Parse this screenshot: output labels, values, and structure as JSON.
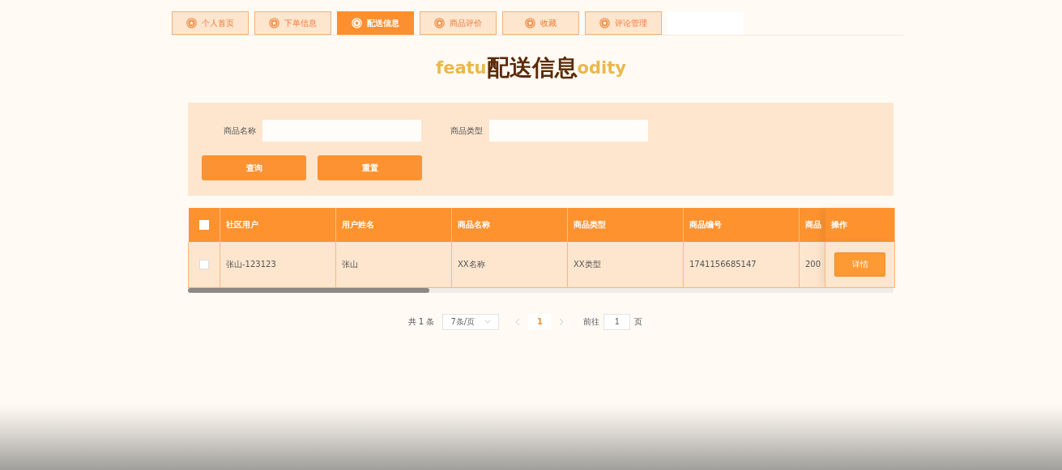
{
  "tabs": [
    {
      "label": "个人首页",
      "selected": false
    },
    {
      "label": "下单信息",
      "selected": false
    },
    {
      "label": "配送信息",
      "selected": true
    },
    {
      "label": "商品评价",
      "selected": false
    },
    {
      "label": "收藏",
      "selected": false
    },
    {
      "label": "评论管理",
      "selected": false
    }
  ],
  "heading": {
    "title": "配送信息",
    "backdrop_left": "featu",
    "backdrop_right": "odity"
  },
  "search": {
    "fields": [
      {
        "label": "商品名称"
      },
      {
        "label": "商品类型"
      }
    ],
    "buttons": [
      "查询",
      "重置"
    ]
  },
  "table": {
    "select_all_checked": false,
    "columns": [
      "社区用户",
      "用户姓名",
      "商品名称",
      "商品类型",
      "商品编号",
      "商品"
    ],
    "action_column": "操作",
    "rows": [
      {
        "checked": false,
        "cells": [
          "张山-123123",
          "张山",
          "XX名称",
          "XX类型",
          "1741156685147",
          "200"
        ],
        "action": "详情"
      }
    ]
  },
  "pagination": {
    "total": "共 1 条",
    "page_size": "7条/页",
    "pages": [
      {
        "label": "1",
        "selected": true
      }
    ],
    "goto_label": "前往",
    "goto_value": "1",
    "goto_suffix": "页"
  }
}
